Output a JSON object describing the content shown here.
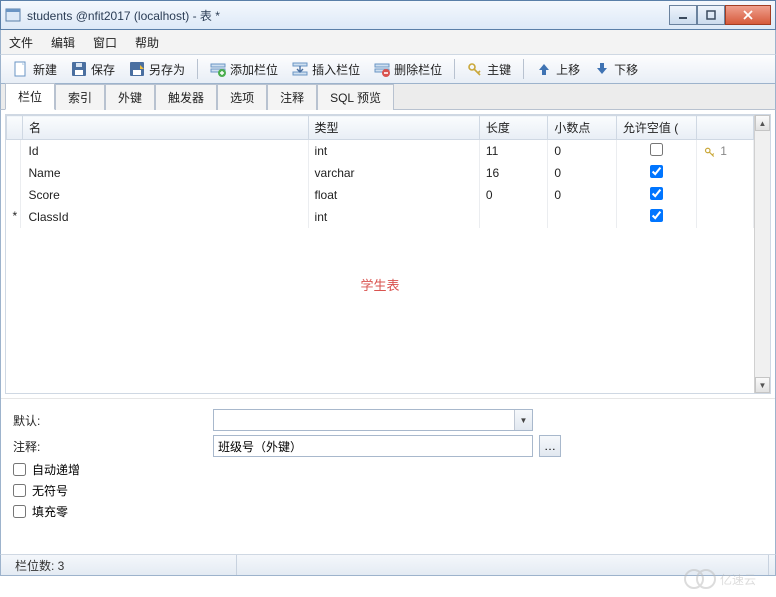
{
  "window": {
    "title": "students @nfit2017 (localhost) - 表 *"
  },
  "menu": {
    "file": "文件",
    "edit": "编辑",
    "window": "窗口",
    "help": "帮助"
  },
  "toolbar": {
    "new": "新建",
    "save": "保存",
    "saveas": "另存为",
    "addfield": "添加栏位",
    "insertfield": "插入栏位",
    "deletefield": "删除栏位",
    "primarykey": "主键",
    "moveup": "上移",
    "movedown": "下移"
  },
  "tabs": {
    "fields": "栏位",
    "indexes": "索引",
    "foreignkeys": "外键",
    "triggers": "触发器",
    "options": "选项",
    "comment": "注释",
    "sqlpreview": "SQL 预览"
  },
  "grid": {
    "header": {
      "name": "名",
      "type": "类型",
      "length": "长度",
      "decimals": "小数点",
      "allownull": "允许空值 ("
    },
    "rows": [
      {
        "marker": "",
        "name": "Id",
        "type": "int",
        "length": "11",
        "decimals": "0",
        "allownull": false,
        "key": "1"
      },
      {
        "marker": "",
        "name": "Name",
        "type": "varchar",
        "length": "16",
        "decimals": "0",
        "allownull": true,
        "key": ""
      },
      {
        "marker": "",
        "name": "Score",
        "type": "float",
        "length": "0",
        "decimals": "0",
        "allownull": true,
        "key": ""
      },
      {
        "marker": "*",
        "name": "ClassId",
        "type": "int",
        "length": "",
        "decimals": "",
        "allownull": true,
        "key": ""
      }
    ],
    "centerlabel": "学生表"
  },
  "props": {
    "default_label": "默认:",
    "default_value": "",
    "comment_label": "注释:",
    "comment_value": "班级号（外键）",
    "autoinc": "自动递增",
    "unsigned": "无符号",
    "zerofill": "填充零"
  },
  "status": {
    "fieldcount": "栏位数: 3"
  },
  "watermark": "亿速云"
}
